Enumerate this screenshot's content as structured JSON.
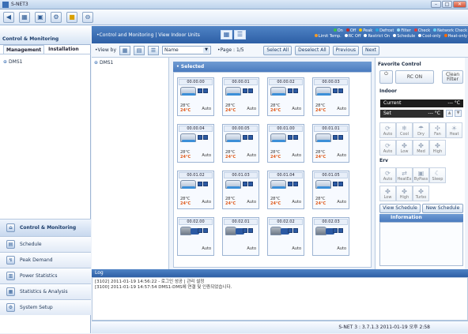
{
  "window": {
    "title": "S-NET3"
  },
  "toolbar": {
    "icons": [
      "back-icon",
      "layout-icon",
      "monitor-icon",
      "settings-icon",
      "folder-icon",
      "circle-icon"
    ]
  },
  "left": {
    "header": "Control & Monitoring",
    "tabs": [
      "Management",
      "Installation"
    ],
    "tree_root": "DMS1",
    "nav": [
      {
        "label": "Control & Monitoring",
        "active": true
      },
      {
        "label": "Schedule"
      },
      {
        "label": "Peak Demand"
      },
      {
        "label": "Power Statistics"
      },
      {
        "label": "Statistics & Analysis"
      },
      {
        "label": "System Setup"
      }
    ]
  },
  "main": {
    "breadcrumb": "•Control and Monitoring | View Indoor Units",
    "legend_row1": [
      "On",
      "Off",
      "Peak",
      "Defrost",
      "Filter",
      "Check",
      "Network Check"
    ],
    "legend_row2": [
      "Limit Temp.",
      "RC Off",
      "Restrict On",
      "Schedule",
      "Cool-only",
      "Heat-only"
    ],
    "legend_colors": [
      "#3fc44a",
      "#c62828",
      "#f2c400",
      "#28a7e0",
      "#9bdcf4",
      "#e23c3c",
      "#6ad0f4",
      "#f39a26",
      "#ffffff",
      "#ffffff",
      "#ffffff",
      "#ffffff",
      "#ff6a00"
    ],
    "viewby_label": "•View by",
    "sort_value": "Name",
    "page_label": "•Page : 1/5",
    "buttons": [
      "Select All",
      "Deselect All",
      "Previous",
      "Next"
    ],
    "tree_item": "DMS1",
    "selected_label": "• Selected"
  },
  "units": [
    {
      "name": "00.00.00",
      "cur": "28°C",
      "set": "24°C",
      "mode": "Auto",
      "on": true
    },
    {
      "name": "00.00.01",
      "cur": "28°C",
      "set": "24°C",
      "mode": "Auto",
      "on": true
    },
    {
      "name": "00.00.02",
      "cur": "28°C",
      "set": "24°C",
      "mode": "Auto",
      "on": true
    },
    {
      "name": "00.00.03",
      "cur": "28°C",
      "set": "24°C",
      "mode": "Auto",
      "on": true
    },
    {
      "name": "00.00.04",
      "cur": "28°C",
      "set": "24°C",
      "mode": "Auto",
      "on": true
    },
    {
      "name": "00.00.05",
      "cur": "28°C",
      "set": "24°C",
      "mode": "Auto",
      "on": true
    },
    {
      "name": "00.01.00",
      "cur": "28°C",
      "set": "24°C",
      "mode": "Auto",
      "on": true
    },
    {
      "name": "00.01.01",
      "cur": "28°C",
      "set": "24°C",
      "mode": "Auto",
      "on": true
    },
    {
      "name": "00.01.02",
      "cur": "28°C",
      "set": "24°C",
      "mode": "Auto",
      "on": true
    },
    {
      "name": "00.01.03",
      "cur": "28°C",
      "set": "24°C",
      "mode": "Auto",
      "on": true
    },
    {
      "name": "00.01.04",
      "cur": "28°C",
      "set": "24°C",
      "mode": "Auto",
      "on": true
    },
    {
      "name": "00.01.05",
      "cur": "28°C",
      "set": "24°C",
      "mode": "Auto",
      "on": true
    },
    {
      "name": "00.02.00",
      "cur": "",
      "set": "",
      "mode": "Auto",
      "on": false
    },
    {
      "name": "00.02.01",
      "cur": "",
      "set": "",
      "mode": "Auto",
      "on": false
    },
    {
      "name": "00.02.02",
      "cur": "",
      "set": "",
      "mode": "Auto",
      "on": false
    },
    {
      "name": "00.02.03",
      "cur": "",
      "set": "",
      "mode": "Auto",
      "on": false
    }
  ],
  "fav": {
    "title": "Favorite Control",
    "rc_on": "RC ON",
    "clean_filter": "Clean Filter",
    "indoor_label": "Indoor",
    "current_label": "Current",
    "current_value": "--- °C",
    "set_label": "Set",
    "set_value": "--- °C",
    "modes": [
      "Auto",
      "Cool",
      "Dry",
      "Fan",
      "Heat"
    ],
    "fans": [
      "Auto",
      "Low",
      "Med",
      "High"
    ],
    "erv_label": "Erv",
    "erv_modes": [
      "Auto",
      "HeatEx",
      "ByPass",
      "Sleep"
    ],
    "erv_fans": [
      "Low",
      "High",
      "Turbo"
    ],
    "view_schedule": "View Schedule",
    "new_schedule": "New Schedule",
    "information": "Information"
  },
  "log": {
    "title": "Log",
    "lines": [
      "[3102] 2011-01-19 14:56:22 - 로그인 성공 | 관리 설정",
      "[3100] 2011-01-19 14:57:54 DMS1-DMS에 연결 및 인증되었습니다."
    ]
  },
  "status": "S-NET 3 : 3.7.1.3   2011-01-19   오후 2:58"
}
